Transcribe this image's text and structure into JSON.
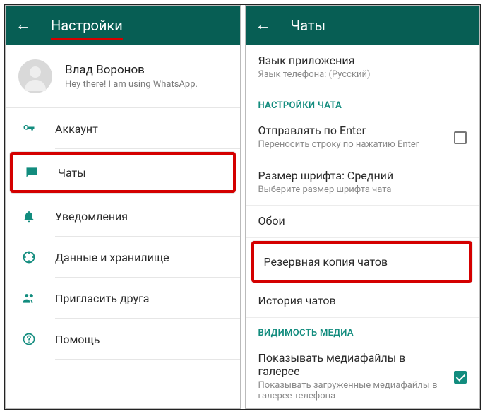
{
  "left": {
    "title": "Настройки",
    "profile": {
      "name": "Влад Воронов",
      "status": "Hey there! I am using WhatsApp."
    },
    "items": [
      {
        "icon": "key-icon",
        "label": "Аккаунт"
      },
      {
        "icon": "chat-icon",
        "label": "Чаты"
      },
      {
        "icon": "bell-icon",
        "label": "Уведомления"
      },
      {
        "icon": "data-icon",
        "label": "Данные и хранилище"
      },
      {
        "icon": "invite-icon",
        "label": "Пригласить друга"
      },
      {
        "icon": "help-icon",
        "label": "Помощь"
      }
    ]
  },
  "right": {
    "title": "Чаты",
    "lang": {
      "title": "Язык приложения",
      "sub": "Язык телефона: (Русский)"
    },
    "section_chat": "НАСТРОЙКИ ЧАТА",
    "enter": {
      "title": "Отправлять по Enter",
      "sub": "Переносить строку по нажатию Enter"
    },
    "font": {
      "title": "Размер шрифта: Средний",
      "sub": "Выберите размер шрифта чата"
    },
    "wallpaper": {
      "title": "Обои"
    },
    "backup": {
      "title": "Резервная копия чатов"
    },
    "history": {
      "title": "История чатов"
    },
    "section_media": "ВИДИМОСТЬ МЕДИА",
    "media": {
      "title": "Показывать медиафайлы в галерее",
      "sub": "Показывать загруженные медиафайлы в галерее телефона"
    }
  }
}
